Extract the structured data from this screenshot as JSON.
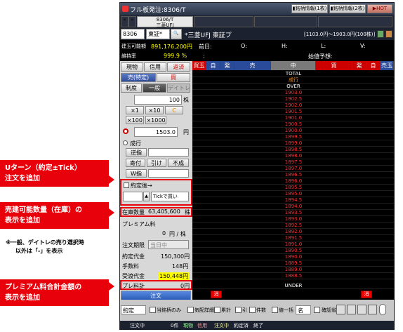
{
  "window": {
    "title": "フル板発注:8306/T",
    "chart1": "銘柄情報(1枚)",
    "chart2": "銘柄情報(2枚)",
    "hot": "HOT"
  },
  "tabs": [
    {
      "code": "8306/T",
      "name": "三菱UFJ"
    },
    {
      "code": "",
      "name": ""
    },
    {
      "code": "",
      "name": ""
    },
    {
      "code": "",
      "name": ""
    }
  ],
  "symbol": {
    "code": "8306",
    "market": "東証*",
    "name": "*三菱UFJ 東証プ",
    "range": "[1103.0円〜1903.0円(100株)]"
  },
  "account": {
    "buying_power_label": "建玉可能額",
    "buying_power": "891,176,200円",
    "margin_label": "維持率",
    "margin": "999.9 %"
  },
  "quote": {
    "prev_close": "前日:",
    "open": "O:",
    "high": "H:",
    "low": "L:",
    "vwap": "V:",
    "expected": "始値予想:"
  },
  "order_tabs": [
    "現物",
    "信用",
    "返済"
  ],
  "side": {
    "sell": "売(特定)",
    "buy": "買"
  },
  "credit": {
    "label": "制度",
    "general": "一般",
    "daytrade": "デイトレ"
  },
  "qty": {
    "value": "100",
    "unit": "株"
  },
  "qty_steps": [
    "×1",
    "×10",
    "C",
    "×100",
    "×1000"
  ],
  "price": {
    "value": "1503.0",
    "unit": "円",
    "market": "成行"
  },
  "cond": {
    "a": "逆指",
    "b": "寄付",
    "c": "引け",
    "d": "不成",
    "e": "W指"
  },
  "uturn": {
    "label": "約定後→",
    "tick": "Tickで買い"
  },
  "stock": {
    "label": "在庫数量",
    "value": "63,405,600",
    "unit": "株"
  },
  "premium": {
    "label": "プレミアム料",
    "value": "0",
    "unit": "円 / 株"
  },
  "period": {
    "label": "注文期限",
    "value": "当日中"
  },
  "summary": [
    {
      "label": "約定代金",
      "value": "150,300円"
    },
    {
      "label": "手数料",
      "value": "148円"
    },
    {
      "label": "受渡代金",
      "value": "150,448円"
    },
    {
      "label": "プレ料計",
      "value": "0円"
    }
  ],
  "submit": "注文",
  "book_headers": [
    "買玉",
    "自",
    "発",
    "売",
    "中",
    "買",
    "発",
    "自",
    "売玉"
  ],
  "book_top": [
    "TOTAL",
    "成行",
    "OVER"
  ],
  "prices": [
    "1903.0",
    "1902.5",
    "1902.0",
    "1901.5",
    "1901.0",
    "1900.5",
    "1900.0",
    "1899.5",
    "1899.0",
    "1898.5",
    "1898.0",
    "1897.5",
    "1897.0",
    "1896.5",
    "1896.0",
    "1895.5",
    "1895.0",
    "1894.5",
    "1894.0",
    "1893.5",
    "1893.0",
    "1892.5",
    "1892.0",
    "1891.5",
    "1891.0",
    "1890.5",
    "1890.0",
    "1889.5",
    "1889.0",
    "1888.5"
  ],
  "under": "UNDER",
  "cancel": "消",
  "bottom": {
    "order_type": "約定",
    "checks": [
      "当銘柄のみ",
      "気配詳細",
      "累計",
      "引",
      "件数",
      "値一括"
    ],
    "qty_select": "名",
    "extra": "確認省略"
  },
  "status": {
    "tab1": "注文中",
    "count": "0件",
    "b1": "現物",
    "b2": "信用",
    "b3": "注文中",
    "b4": "約定済",
    "b5": "終了"
  },
  "callouts": {
    "c1": "Uターン（約定±Tick）注文を追加",
    "c1a": "Uターン（約定±Tick）",
    "c1b": "注文を追加",
    "c2a": "売建可能数量（在庫）の",
    "c2b": "表示を追加",
    "note1": "※一般、デイトレの売り選択時",
    "note2": "以外は「-」を表示",
    "c3a": "プレミアム料合計金額の",
    "c3b": "表示を追加"
  }
}
